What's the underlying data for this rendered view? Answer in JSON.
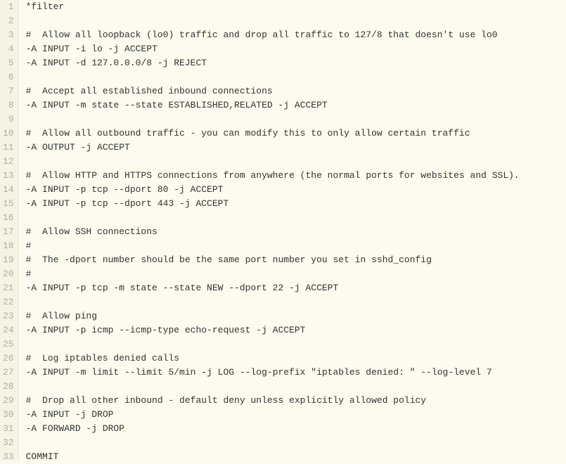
{
  "code_lines": [
    "*filter",
    "",
    "#  Allow all loopback (lo0) traffic and drop all traffic to 127/8 that doesn't use lo0",
    "-A INPUT -i lo -j ACCEPT",
    "-A INPUT -d 127.0.0.0/8 -j REJECT",
    "",
    "#  Accept all established inbound connections",
    "-A INPUT -m state --state ESTABLISHED,RELATED -j ACCEPT",
    "",
    "#  Allow all outbound traffic - you can modify this to only allow certain traffic",
    "-A OUTPUT -j ACCEPT",
    "",
    "#  Allow HTTP and HTTPS connections from anywhere (the normal ports for websites and SSL).",
    "-A INPUT -p tcp --dport 80 -j ACCEPT",
    "-A INPUT -p tcp --dport 443 -j ACCEPT",
    "",
    "#  Allow SSH connections",
    "#",
    "#  The -dport number should be the same port number you set in sshd_config",
    "#",
    "-A INPUT -p tcp -m state --state NEW --dport 22 -j ACCEPT",
    "",
    "#  Allow ping",
    "-A INPUT -p icmp --icmp-type echo-request -j ACCEPT",
    "",
    "#  Log iptables denied calls",
    "-A INPUT -m limit --limit 5/min -j LOG --log-prefix \"iptables denied: \" --log-level 7",
    "",
    "#  Drop all other inbound - default deny unless explicitly allowed policy",
    "-A INPUT -j DROP",
    "-A FORWARD -j DROP",
    "",
    "COMMIT"
  ]
}
